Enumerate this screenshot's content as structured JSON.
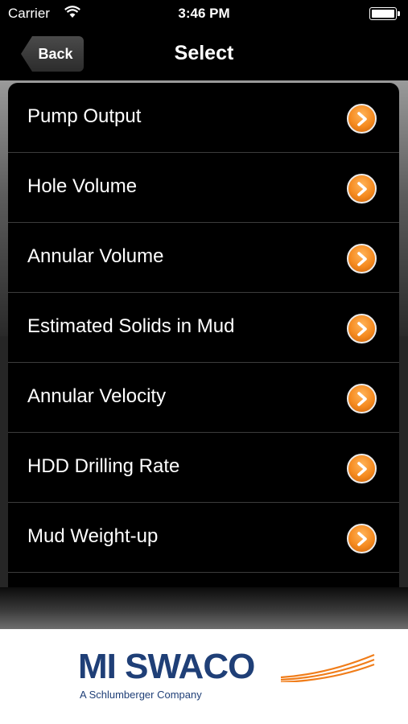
{
  "status_bar": {
    "carrier": "Carrier",
    "time": "3:46 PM",
    "battery_level": 1.0
  },
  "nav": {
    "back_label": "Back",
    "title": "Select"
  },
  "menu_items": [
    {
      "label": "Pump Output",
      "icon": "chevron-right-icon"
    },
    {
      "label": "Hole Volume",
      "icon": "chevron-right-icon"
    },
    {
      "label": "Annular Volume",
      "icon": "chevron-right-icon"
    },
    {
      "label": "Estimated Solids in Mud",
      "icon": "chevron-right-icon"
    },
    {
      "label": "Annular Velocity",
      "icon": "chevron-right-icon"
    },
    {
      "label": "HDD Drilling Rate",
      "icon": "chevron-right-icon"
    },
    {
      "label": "Mud Weight-up",
      "icon": "chevron-right-icon"
    }
  ],
  "footer": {
    "logo_text": "MI SWACO",
    "tagline": "A Schlumberger Company"
  },
  "colors": {
    "accent_orange": "#f58a1f",
    "logo_blue": "#1f3f77",
    "swoosh_orange": "#f07d1a"
  }
}
